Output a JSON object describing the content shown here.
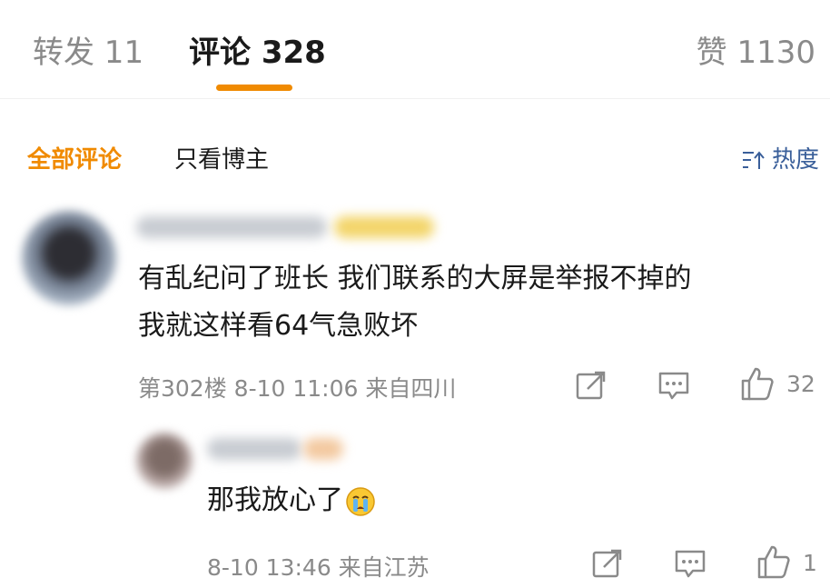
{
  "colors": {
    "accent": "#f08a00",
    "text": "#1a1a1a",
    "muted": "#8a8a8a",
    "sort": "#3a5f9a"
  },
  "tabs": {
    "repost": "转发 11",
    "comments": "评论 328",
    "likes": "赞 1130"
  },
  "filters": {
    "all": "全部评论",
    "author_only": "只看博主",
    "sort": "热度"
  },
  "comments": [
    {
      "text_line1": "有乱纪问了班长 我们联系的大屏是举报不掉的",
      "text_line2": "我就这样看64气急败坏",
      "meta": "第302楼 8-10 11:06 来自四川",
      "likes": "32"
    }
  ],
  "replies": [
    {
      "text": "那我放心了",
      "emoji": "crying-face-icon",
      "meta": "8-10 13:46 来自江苏",
      "likes": "1"
    }
  ]
}
